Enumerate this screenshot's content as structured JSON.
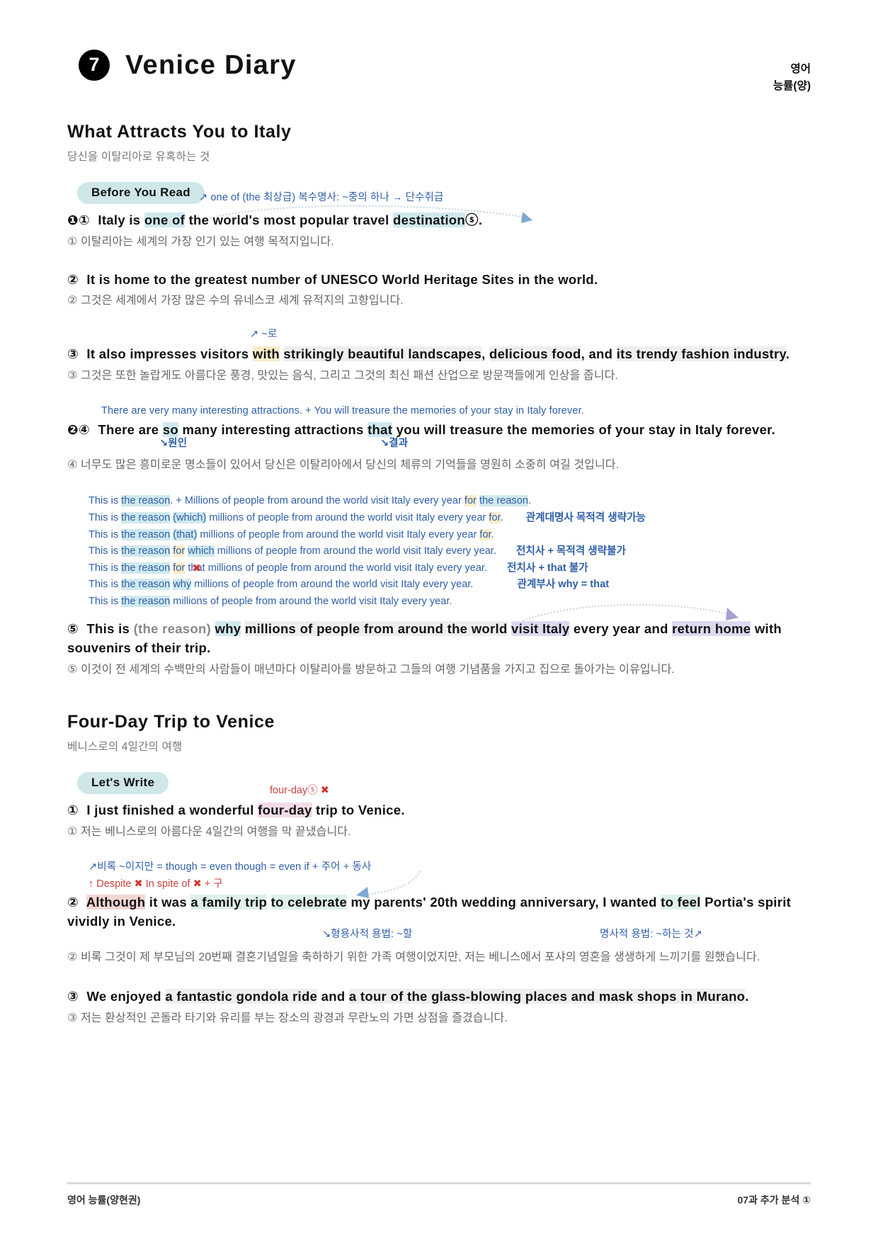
{
  "header": {
    "unit_number": "7",
    "title": "Venice Diary",
    "subject_line1": "영어",
    "subject_line2": "능률(양)"
  },
  "sections": [
    {
      "title": "What Attracts You to Italy",
      "subtitle": "당신을 이탈리아로 유혹하는 것",
      "pill": "Before You Read"
    },
    {
      "title": "Four-Day Trip to Venice",
      "subtitle": "베니스로의 4일간의 여행",
      "pill": "Let's Write"
    }
  ],
  "s1": {
    "anno1": "one of (the 최상급) 복수명사: ~중의 하나 → 단수취급",
    "bullet": "❶",
    "num": "①",
    "en_a": "Italy is ",
    "en_b": "one of",
    "en_c": " the world's most popular travel ",
    "en_d": "destination",
    "en_circ": "ⓢ",
    "en_e": ".",
    "ko": "① 이탈리아는 세계의 가장 인기 있는 여행 목적지입니다."
  },
  "s2": {
    "num": "②",
    "en": "It is home to the greatest number of UNESCO World Heritage Sites in the world.",
    "ko": "② 그것은 세계에서 가장 많은 수의 유네스코 세계 유적지의 고향입니다."
  },
  "s3": {
    "anno1": "~로",
    "num": "③",
    "en_a": "It also impresses visitors ",
    "en_with": "with",
    "en_b": "strikingly beautiful landscapes",
    "en_c": ", ",
    "en_d": "delicious food",
    "en_e": ", and ",
    "en_f": "its trendy fashion industry",
    "en_g": ".",
    "ko": "③ 그것은 또한 놀랍게도 아름다운 풍경, 맛있는 음식, 그리고 그것의 최신 패션 산업으로 방문객들에게 인상을 줍니다."
  },
  "s4": {
    "anno_top": "There are very many interesting attractions. + You will treasure the memories of your stay in Italy forever.",
    "bullet": "❷",
    "num": "④",
    "en_a": "There are ",
    "en_so": "so",
    "en_b": " many interesting attractions ",
    "en_that": "that",
    "en_c": " you will treasure the memories of your stay in Italy forever.",
    "label_cause": "원인",
    "label_effect": "결과",
    "ko": "④ 너무도 많은 흥미로운 명소들이 있어서 당신은 이탈리아에서 당신의 체류의 기억들을 영원히 소중히 여길 것입니다."
  },
  "reason_block": {
    "lines": [
      {
        "pre": "This is ",
        "hl1": "the reason",
        "mid": ". + Millions of people from around the world visit Italy every year ",
        "hlfor": "for",
        "mid2": " ",
        "hl2": "the reason",
        "post": ".",
        "note": ""
      },
      {
        "pre": "This is ",
        "hl1": "the reason",
        "mid": " ",
        "hlrel": "(which)",
        "mid2": " millions of people from around the world visit Italy every year ",
        "hlfor": "for",
        "post": ".",
        "note": "관계대명사 목적격 생략가능"
      },
      {
        "pre": "This is ",
        "hl1": "the reason",
        "mid": " ",
        "hlrel": "(that)",
        "mid2": " millions of people from around the world visit Italy every year ",
        "hlfor": "for",
        "post": ".",
        "note": ""
      },
      {
        "pre": "This is ",
        "hl1": "the reason",
        "mid": " ",
        "hlfor": "for",
        "mid2": " ",
        "hlrel": "which",
        "post": " millions of people from around the world visit Italy every year.",
        "note": "전치사 + 목적격 생략불가"
      },
      {
        "pre": "This is ",
        "hl1": "the reason",
        "mid": " ",
        "hlfor": "for",
        "mid2": " ",
        "strike": "that",
        "post": " millions of people from around the world visit Italy every year.",
        "note": "전치사 + that 불가"
      },
      {
        "pre": "This is ",
        "hl1": "the reason",
        "mid": " ",
        "hlwhy": "why",
        "post": " millions of people from around the world visit Italy every year.",
        "note": "관계부사 why = that"
      },
      {
        "pre": "This is ",
        "hl1": "the reason",
        "post": " millions of people from around the world visit Italy every year.",
        "note": ""
      }
    ]
  },
  "s5": {
    "num": "⑤",
    "en_a": "This is ",
    "en_paren": "(the reason)",
    "en_why": "why",
    "en_b": "millions of people from around the world",
    "en_c": " ",
    "en_visit": "visit Italy",
    "en_d": " every year and ",
    "en_return": "return home",
    "en_e": " with souvenirs of their trip.",
    "ko": "⑤ 이것이 전 세계의 수백만의 사람들이 매년마다 이탈리아를 방문하고 그들의 여행 기념품을 가지고 집으로 돌아가는 이유입니다."
  },
  "w1": {
    "anno_red": "four-day",
    "anno_red_circ": "ⓢ",
    "anno_red_x": "✖",
    "num": "①",
    "en_a": "I just finished a wonderful ",
    "en_hl": "four-day",
    "en_b": " trip to Venice.",
    "ko": "① 저는 베니스로의 아름다운 4일간의 여행을 막 끝냈습니다."
  },
  "w2": {
    "anno1": "비록 ~이지만 = though = even though = even if + 주어 + 동사",
    "anno2_a": "Despite",
    "anno2_x1": "✖",
    "anno2_b": "In spite of",
    "anno2_x2": "✖",
    "anno2_c": "+ 구",
    "num": "②",
    "en_although": "Although",
    "en_a": " it was ",
    "en_b": "a family trip",
    "en_c": " ",
    "en_d": "to celebrate",
    "en_e": " my parents' 20th wedding anniversary, I wanted ",
    "en_f": "to feel",
    "en_g": " Portia's spirit vividly in Venice.",
    "label_adj": "형용사적 용법: ~할",
    "label_noun": "명사적 용법: ~하는 것",
    "ko": "② 비록 그것이 제 부모님의 20번째 결혼기념일을 축하하기 위한 가족 여행이었지만, 저는 베니스에서 포샤의 영혼을 생생하게 느끼기를 원했습니다."
  },
  "w3": {
    "num": "③",
    "en_a": "We enjoyed ",
    "en_b": "a fantastic gondola ride",
    "en_c": " and ",
    "en_d": "a tour of the glass-blowing places and mask shops in Murano",
    "en_e": ".",
    "ko": "③ 저는 환상적인 곤돌라 타기와 유리를 부는 장소의 광경과 무란노의 가면 상점을 즐겼습니다."
  },
  "footer": {
    "left": "영어 능률(양현권)",
    "right": "07과 추가 분석 ①"
  }
}
